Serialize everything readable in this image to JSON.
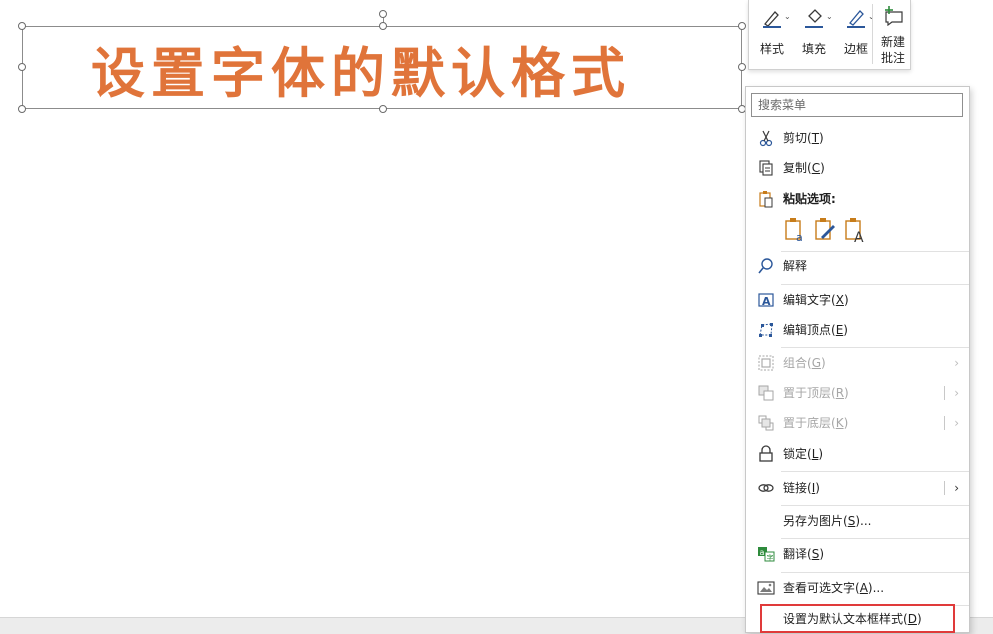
{
  "slide": {
    "textbox_title": "设置字体的默认格式"
  },
  "mini_toolbar": {
    "style_label": "样式",
    "fill_label": "填充",
    "border_label": "边框",
    "new_comment_line1": "新建",
    "new_comment_line2": "批注"
  },
  "context_menu": {
    "search_placeholder": "搜索菜单",
    "items": {
      "cut": {
        "text": "剪切",
        "key": "T"
      },
      "copy": {
        "text": "复制",
        "key": "C"
      },
      "paste_options": {
        "text": "粘贴选项:"
      },
      "explain": {
        "text": "解释"
      },
      "edit_text": {
        "text": "编辑文字",
        "key": "X"
      },
      "edit_points": {
        "text": "编辑顶点",
        "key": "E"
      },
      "group": {
        "text": "组合",
        "key": "G"
      },
      "bring_front": {
        "text": "置于顶层",
        "key": "R"
      },
      "send_back": {
        "text": "置于底层",
        "key": "K"
      },
      "lock": {
        "text": "锁定",
        "key": "L"
      },
      "link": {
        "text": "链接",
        "key": "I"
      },
      "save_as_picture": {
        "text": "另存为图片",
        "key": "S",
        "suffix": "..."
      },
      "translate": {
        "text": "翻译",
        "key": "S"
      },
      "view_alt_text": {
        "text": "查看可选文字",
        "key": "A",
        "suffix": "..."
      },
      "set_default_textbox": {
        "text": "设置为默认文本框样式",
        "key": "D"
      }
    }
  },
  "colors": {
    "title_orange": "#e0743a",
    "highlight_red": "#e03a3a",
    "icon_blue": "#2b579a"
  }
}
